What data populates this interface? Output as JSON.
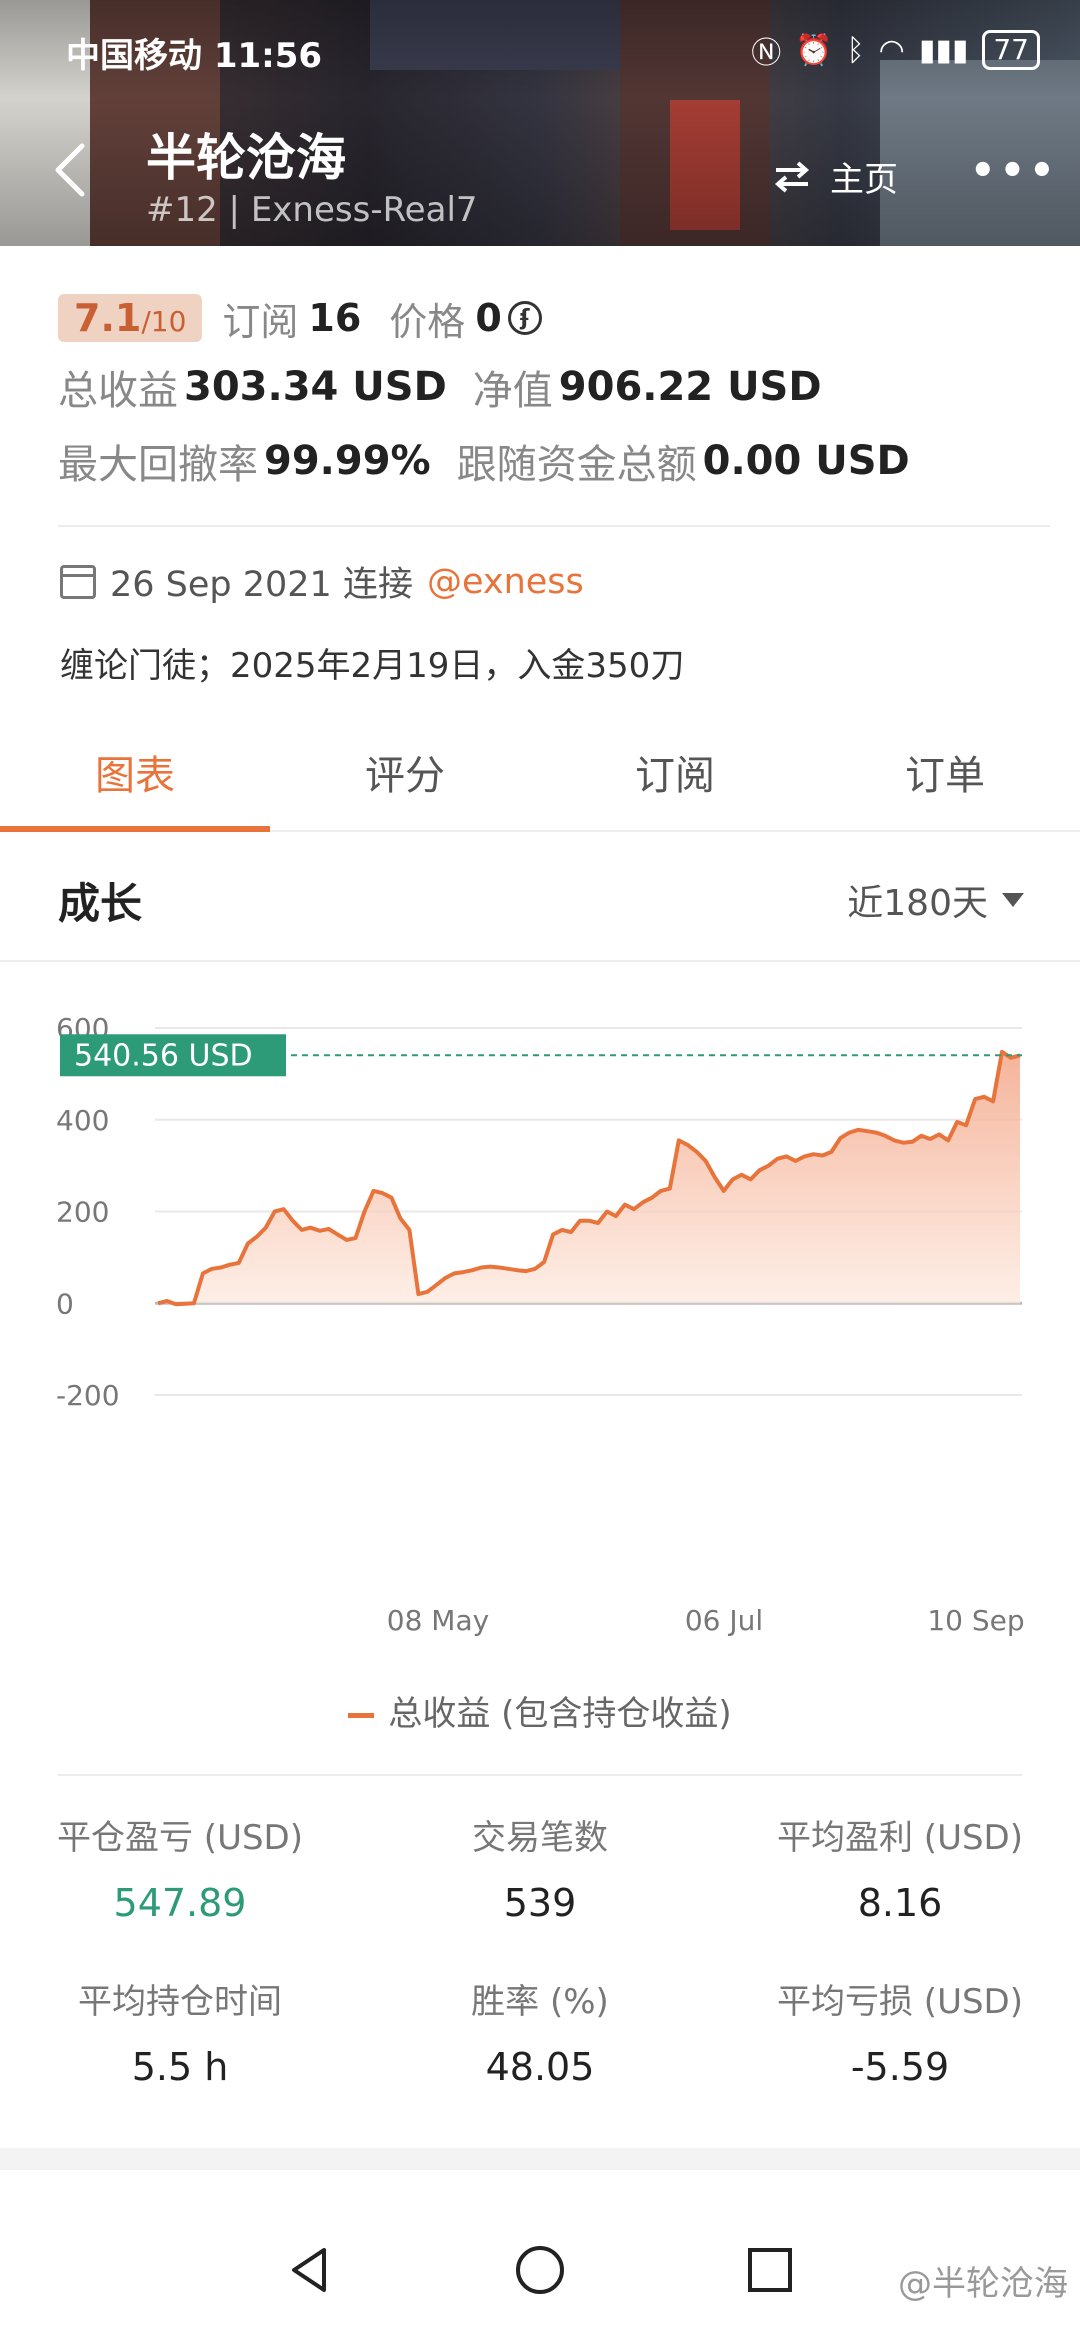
{
  "status_bar": {
    "carrier": "中国移动",
    "time": "11:56",
    "battery": "77"
  },
  "header": {
    "title": "半轮沧海",
    "subtitle": "#12 | Exness-Real7",
    "home_label": "主页",
    "more_label": "•••"
  },
  "summary": {
    "score": "7.1",
    "score_max": "/10",
    "subscribe_label": "订阅",
    "subscribe_count": "16",
    "price_label": "价格",
    "price_value": "0",
    "total_profit_label": "总收益",
    "total_profit_value": "303.34 USD",
    "equity_label": "净值",
    "equity_value": "906.22 USD",
    "max_drawdown_label": "最大回撤率",
    "max_drawdown_value": "99.99%",
    "follow_funds_label": "跟随资金总额",
    "follow_funds_value": "0.00 USD"
  },
  "connection": {
    "date_text": "26 Sep 2021 连接",
    "broker": "@exness",
    "description": "缠论门徒；2025年2月19日，入金350刀"
  },
  "tabs": [
    {
      "label": "图表",
      "active": true
    },
    {
      "label": "评分",
      "active": false
    },
    {
      "label": "订阅",
      "active": false
    },
    {
      "label": "订单",
      "active": false
    }
  ],
  "growth": {
    "title": "成长",
    "range_label": "近180天"
  },
  "chart_data": {
    "type": "area",
    "y_ticks": [
      "600",
      "400",
      "200",
      "0",
      "-200"
    ],
    "x_ticks": [
      "08 May",
      "06 Jul",
      "10 Sep"
    ],
    "ylim": [
      -200,
      600
    ],
    "current_value_label": "540.56 USD",
    "current_value": 540.56,
    "series": [
      {
        "name": "总收益 (包含持仓收益)",
        "color": "#e8743b",
        "values": [
          0,
          5,
          -2,
          -1,
          0,
          65,
          75,
          78,
          84,
          88,
          130,
          145,
          165,
          200,
          205,
          180,
          160,
          165,
          158,
          162,
          150,
          138,
          142,
          200,
          245,
          240,
          230,
          185,
          160,
          20,
          25,
          40,
          55,
          65,
          68,
          72,
          78,
          80,
          78,
          75,
          72,
          70,
          75,
          90,
          150,
          160,
          155,
          180,
          180,
          175,
          200,
          190,
          215,
          205,
          220,
          230,
          245,
          250,
          355,
          345,
          330,
          310,
          275,
          245,
          270,
          280,
          270,
          290,
          300,
          315,
          320,
          310,
          320,
          325,
          322,
          330,
          360,
          372,
          378,
          375,
          372,
          365,
          355,
          350,
          352,
          365,
          358,
          368,
          355,
          395,
          388,
          445,
          450,
          440,
          548,
          535,
          540.56
        ]
      }
    ],
    "legend_position": "bottom-center",
    "grid": true
  },
  "legend_label": "总收益 (包含持仓收益)",
  "stats": [
    {
      "label": "平仓盈亏 (USD)",
      "value": "547.89",
      "green": true
    },
    {
      "label": "交易笔数",
      "value": "539",
      "green": false
    },
    {
      "label": "平均盈利 (USD)",
      "value": "8.16",
      "green": false
    },
    {
      "label": "平均持仓时间",
      "value": "5.5 h",
      "green": false
    },
    {
      "label": "胜率 (%)",
      "value": "48.05",
      "green": false
    },
    {
      "label": "平均亏损 (USD)",
      "value": "-5.59",
      "green": false
    }
  ],
  "watermark": "@半轮沧海"
}
